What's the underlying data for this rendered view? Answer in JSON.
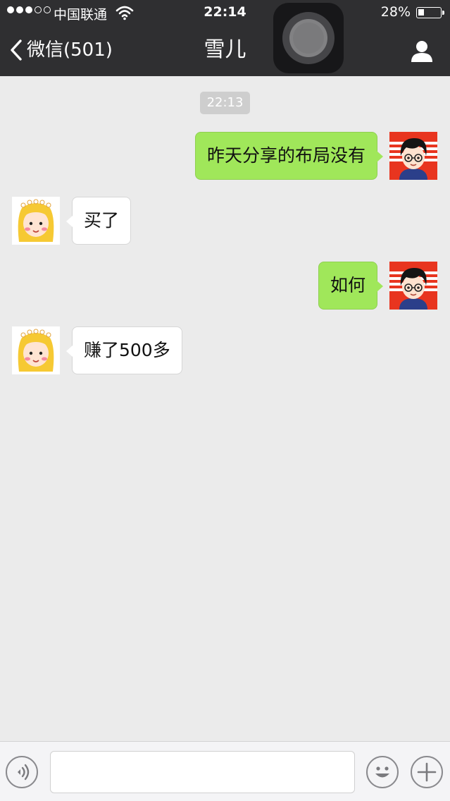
{
  "status_bar": {
    "carrier": "中国联通",
    "time": "22:14",
    "battery": "28%",
    "battery_level": 0.28,
    "signal_bars_filled": 3,
    "signal_bars_total": 5
  },
  "navbar": {
    "back_label": "微信(501)",
    "title": "雪儿"
  },
  "chat": {
    "timestamp": "22:13",
    "messages": [
      {
        "side": "out",
        "text": "昨天分享的布局没有"
      },
      {
        "side": "in",
        "text": "买了"
      },
      {
        "side": "out",
        "text": "如何"
      },
      {
        "side": "in",
        "text": "赚了500多"
      }
    ]
  },
  "input_bar": {
    "text_value": "",
    "icons": [
      "voice-icon",
      "emoji-icon",
      "plus-icon"
    ]
  },
  "colors": {
    "navbar_bg": "#2f2f31",
    "chat_bg": "#ebebeb",
    "outgoing_bubble": "#a0e75a",
    "incoming_bubble": "#ffffff"
  }
}
